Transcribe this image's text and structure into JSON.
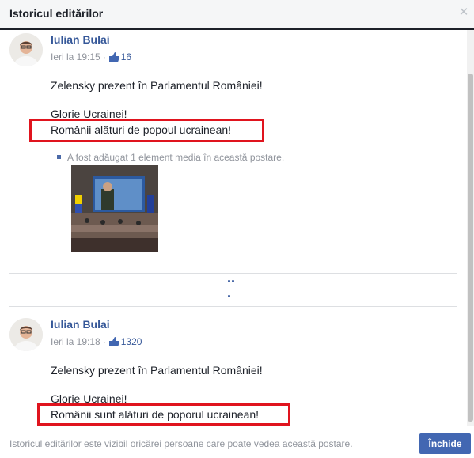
{
  "dialog": {
    "title": "Istoricul editărilor",
    "close_icon": "close-icon"
  },
  "entries": [
    {
      "author": "Iulian Bulai",
      "time": "Ieri la 19:15",
      "like_count": "16",
      "lines": [
        "Zelensky prezent în Parlamentul României!",
        "Glorie Ucrainei!",
        "Românii alături de popoul ucrainean!"
      ],
      "media_note": "A fost adăugat 1 element media în această postare."
    },
    {
      "author": "Iulian Bulai",
      "time": "Ieri la 19:18",
      "like_count": "1320",
      "lines": [
        "Zelensky prezent în Parlamentul României!",
        "Glorie Ucrainei!",
        "Românii sunt alături de poporul ucrainean!"
      ]
    }
  ],
  "footer": {
    "note": "Istoricul editărilor este vizibil oricărei persoane care poate vedea această postare.",
    "close_label": "Închide"
  },
  "colors": {
    "link": "#365899",
    "highlight": "#e0141e",
    "button": "#4267b2"
  }
}
